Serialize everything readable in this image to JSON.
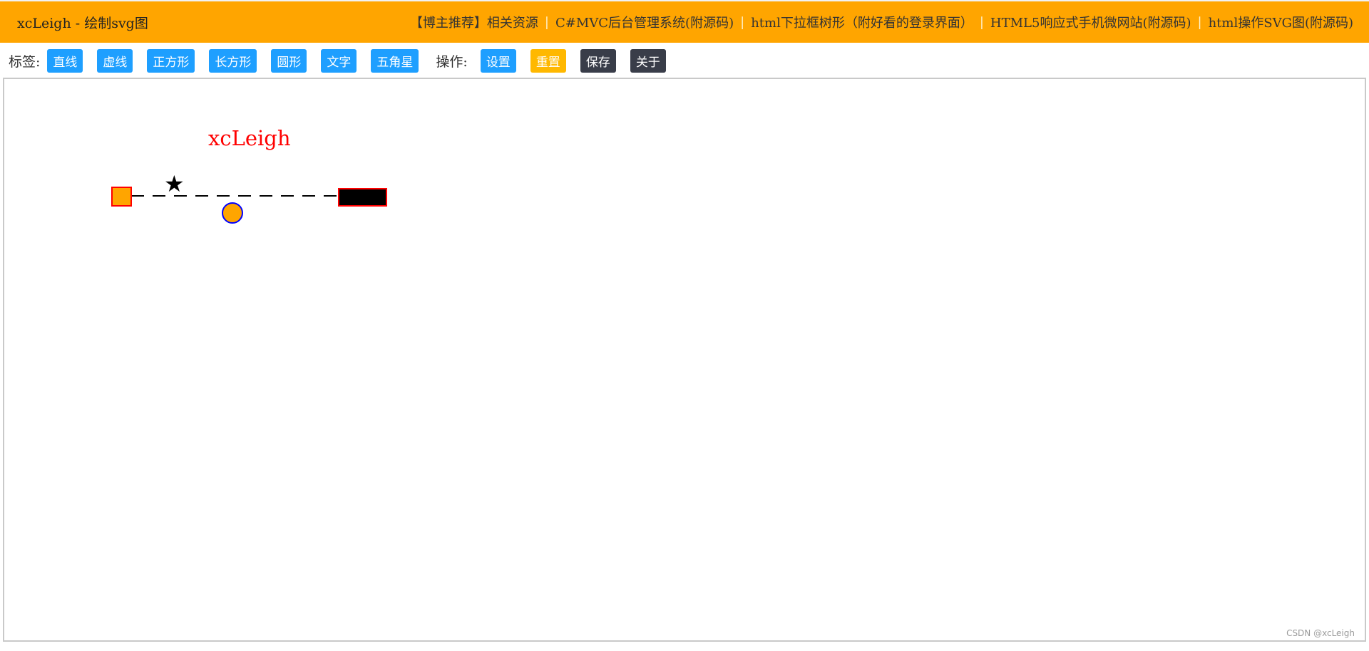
{
  "header": {
    "title": "xcLeigh - 绘制svg图",
    "recommend_label": "【博主推荐】",
    "links": [
      "相关资源",
      "C#MVC后台管理系统(附源码)",
      "html下拉框树形（附好看的登录界面）",
      "HTML5响应式手机微网站(附源码)",
      "html操作SVG图(附源码)"
    ],
    "link_separator": "|"
  },
  "toolbar": {
    "tags_label": "标签:",
    "tag_buttons": [
      "直线",
      "虚线",
      "正方形",
      "长方形",
      "圆形",
      "文字",
      "五角星"
    ],
    "ops_label": "操作:",
    "op_buttons": [
      "设置",
      "重置",
      "保存",
      "关于"
    ]
  },
  "canvas": {
    "text_shape": "xcLeigh",
    "star_glyph": "★",
    "colors": {
      "text": "#ff0000",
      "square_fill": "#ffa500",
      "square_stroke": "#ff0000",
      "rect_fill": "#000000",
      "rect_stroke": "#ff0000",
      "circle_fill": "#ffa500",
      "circle_stroke": "#0000ff",
      "dashed_line": "#000000",
      "star": "#000000"
    }
  },
  "watermark": "CSDN @xcLeigh",
  "colors": {
    "header_bg": "#ffa500",
    "btn_blue": "#1e9fff",
    "btn_yellow": "#ffb800",
    "btn_dark": "#393d49"
  }
}
